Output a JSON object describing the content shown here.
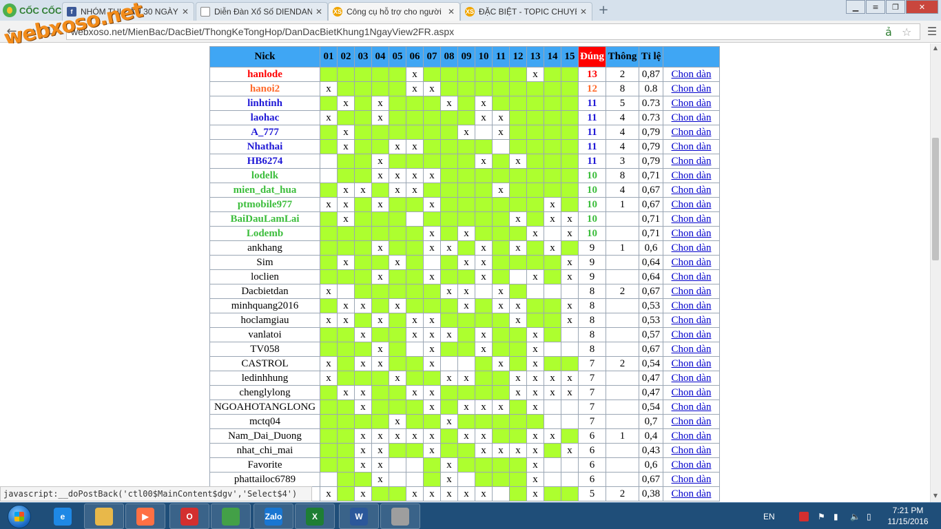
{
  "browser": {
    "brand": "CỐC CỐC",
    "tabs": [
      {
        "title": "NHÓM THI ĐẤU 30 NGÀY",
        "icon": "facebook-icon"
      },
      {
        "title": "Diễn Đàn Xổ Số DIENDAN",
        "icon": "document-icon"
      },
      {
        "title": "Công cụ hỗ trợ cho người",
        "icon": "xs-icon"
      },
      {
        "title": "ĐẶC BIỆT - TOPIC CHUYÊN",
        "icon": "xs-icon"
      }
    ],
    "address": "webxoso.net/MienBac/DacBiet/ThongKeTongHop/DanDacBietKhung1NgayView2FR.aspx",
    "watermark": "webxoso.net",
    "status_text": "javascript:__doPostBack('ctl00$MainContent$dgv','Select$4')"
  },
  "table": {
    "headers": {
      "nick": "Nick",
      "days": [
        "01",
        "02",
        "03",
        "04",
        "05",
        "06",
        "07",
        "08",
        "09",
        "10",
        "11",
        "12",
        "13",
        "14",
        "15"
      ],
      "dung": "Đúng",
      "thong": "Thông",
      "tile": "Tỉ lệ"
    },
    "colors": {
      "red": "#ff0000",
      "orange": "#ff6a2b",
      "blue": "#1f18d6",
      "green": "#3bbd3b",
      "black": "#000000"
    },
    "link_label": "Chon dàn",
    "rows": [
      {
        "nick": "hanlode",
        "color": "red",
        "bold": true,
        "cells": "gggg g x g g g g g g x g g",
        "dung": "13",
        "thong": "2",
        "tile": "0,87"
      },
      {
        "nick": "hanoi2",
        "color": "orange",
        "bold": true,
        "cells": "xg g g g x x g g g g g g g g",
        "dung": "12",
        "thong": "8",
        "tile": "0.8"
      },
      {
        "nick": "linhtinh",
        "color": "blue",
        "bold": true,
        "cells": "g x g x g g g x g x g g g g g",
        "dung": "11",
        "thong": "5",
        "tile": "0.73"
      },
      {
        "nick": "laohac",
        "color": "blue",
        "bold": true,
        "cells": "x g g x g g g g g x x g g g g",
        "dung": "11",
        "thong": "4",
        "tile": "0.73"
      },
      {
        "nick": "A_777",
        "color": "blue",
        "bold": true,
        "cells": "g x g g g g g g x w x g g g g",
        "dung": "11",
        "thong": "4",
        "tile": "0,79"
      },
      {
        "nick": "Nhathai",
        "color": "blue",
        "bold": true,
        "cells": "g x g g x x g g g g w g g g g",
        "dung": "11",
        "thong": "4",
        "tile": "0,79"
      },
      {
        "nick": "HB6274",
        "color": "blue",
        "bold": true,
        "cells": "w g g x g g g g g x g x g g g",
        "dung": "11",
        "thong": "3",
        "tile": "0,79"
      },
      {
        "nick": "lodelk",
        "color": "green",
        "bold": true,
        "cells": "w g g x x x x g g g g g g g g",
        "dung": "10",
        "thong": "8",
        "tile": "0,71"
      },
      {
        "nick": "mien_dat_hua",
        "color": "green",
        "bold": true,
        "cells": "g x x g x x g g g g x g g g g",
        "dung": "10",
        "thong": "4",
        "tile": "0,67"
      },
      {
        "nick": "ptmobile977",
        "color": "green",
        "bold": true,
        "cells": "x x g x g g x g g g g g g x g",
        "dung": "10",
        "thong": "1",
        "tile": "0,67"
      },
      {
        "nick": "BaiDauLamLai",
        "color": "green",
        "bold": true,
        "cells": "g x g g g w g g g g g x g x x",
        "dung": "10",
        "thong": "",
        "tile": "0,71"
      },
      {
        "nick": "Lodemb",
        "color": "green",
        "bold": true,
        "cells": "g g g g g g x g x g g g x w x",
        "dung": "10",
        "thong": "",
        "tile": "0,71"
      },
      {
        "nick": "ankhang",
        "color": "black",
        "bold": false,
        "cells": "g g g x g g x x g x g x g x g",
        "dung": "9",
        "thong": "1",
        "tile": "0,6"
      },
      {
        "nick": "Sim",
        "color": "black",
        "bold": false,
        "cells": "g x g g x g w g x x g g g g x",
        "dung": "9",
        "thong": "",
        "tile": "0,64"
      },
      {
        "nick": "loclien",
        "color": "black",
        "bold": false,
        "cells": "g g g x g g x g g x g w x g x",
        "dung": "9",
        "thong": "",
        "tile": "0,64"
      },
      {
        "nick": "Dacbietdan",
        "color": "black",
        "bold": false,
        "cells": "x w g g g g g x x w x g w w w",
        "dung": "8",
        "thong": "2",
        "tile": "0,67"
      },
      {
        "nick": "minhquang2016",
        "color": "black",
        "bold": false,
        "cells": "g x x g x g g g x g x x g g x",
        "dung": "8",
        "thong": "",
        "tile": "0,53"
      },
      {
        "nick": "hoclamgiau",
        "color": "black",
        "bold": false,
        "cells": "x x g x g x x g g g g x g g x",
        "dung": "8",
        "thong": "",
        "tile": "0,53"
      },
      {
        "nick": "vanlatoi",
        "color": "black",
        "bold": false,
        "cells": "g g x g g x x x g x g g x g w",
        "dung": "8",
        "thong": "",
        "tile": "0,57"
      },
      {
        "nick": "TV058",
        "color": "black",
        "bold": false,
        "cells": "g g g x g w x g g x g g x w w",
        "dung": "8",
        "thong": "",
        "tile": "0,67"
      },
      {
        "nick": "CASTROL",
        "color": "black",
        "bold": false,
        "cells": "x g x x g g x w w g x g x g g",
        "dung": "7",
        "thong": "2",
        "tile": "0,54"
      },
      {
        "nick": "ledinhhung",
        "color": "black",
        "bold": false,
        "cells": "x g g g x g g x x g g x x x x",
        "dung": "7",
        "thong": "",
        "tile": "0,47"
      },
      {
        "nick": "chenglylong",
        "color": "black",
        "bold": false,
        "cells": "g x x g g x x g g g g x x x x",
        "dung": "7",
        "thong": "",
        "tile": "0,47"
      },
      {
        "nick": "NGOAHOTANGLONG",
        "color": "black",
        "bold": false,
        "cells": "g g x g g g x g x x x g x w w",
        "dung": "7",
        "thong": "",
        "tile": "0,54"
      },
      {
        "nick": "mctq04",
        "color": "black",
        "bold": false,
        "cells": "g g g g x g g x g g g g g w w",
        "dung": "7",
        "thong": "",
        "tile": "0,7"
      },
      {
        "nick": "Nam_Dai_Duong",
        "color": "black",
        "bold": false,
        "cells": "g g x x x x x g x x g g x x g",
        "dung": "6",
        "thong": "1",
        "tile": "0,4"
      },
      {
        "nick": "nhat_chi_mai",
        "color": "black",
        "bold": false,
        "cells": "g g x x g g x g g x x x x g x",
        "dung": "6",
        "thong": "",
        "tile": "0,43"
      },
      {
        "nick": "Favorite",
        "color": "black",
        "bold": false,
        "cells": "g g x x w w g x g g g g x w w",
        "dung": "6",
        "thong": "",
        "tile": "0,6"
      },
      {
        "nick": "phattailoc6789",
        "color": "black",
        "bold": false,
        "cells": "w g g x w w g x w g g g x w w",
        "dung": "6",
        "thong": "",
        "tile": "0,67"
      },
      {
        "nick": "",
        "color": "black",
        "bold": false,
        "cells": "x g x g g x x x x x w g x g g",
        "dung": "5",
        "thong": "2",
        "tile": "0,38"
      }
    ]
  },
  "taskbar": {
    "apps": [
      {
        "name": "internet-explorer",
        "label": "e",
        "color": "#1e88e5"
      },
      {
        "name": "file-explorer",
        "label": "",
        "color": "#e8b84a"
      },
      {
        "name": "media-player",
        "label": "▶",
        "color": "#ff7043"
      },
      {
        "name": "opera",
        "label": "O",
        "color": "#d32f2f"
      },
      {
        "name": "coccoc",
        "label": "",
        "color": "#43a047"
      },
      {
        "name": "zalo",
        "label": "Zalo",
        "color": "#1976d2"
      },
      {
        "name": "excel",
        "label": "X",
        "color": "#1e7e34"
      },
      {
        "name": "word",
        "label": "W",
        "color": "#2b579a"
      },
      {
        "name": "paint",
        "label": "",
        "color": "#9e9e9e"
      }
    ],
    "lang": "EN",
    "time": "7:21 PM",
    "date": "11/15/2016"
  }
}
